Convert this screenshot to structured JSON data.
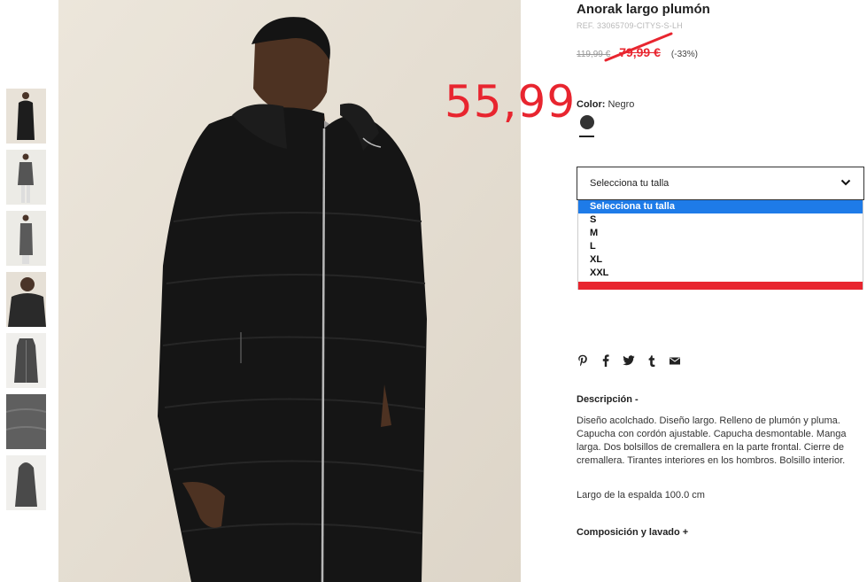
{
  "product": {
    "title": "Anorak largo plumón",
    "ref": "REF. 33065709-CITYS-S-LH",
    "old_price": "119,99 €",
    "sale_price": "79,99 €",
    "discount": "(-33%)",
    "annotation_price": "55,99"
  },
  "color": {
    "label": "Color:",
    "value": "Negro",
    "swatch": "#333333"
  },
  "size_select": {
    "placeholder": "Selecciona tu talla",
    "options": [
      "Selecciona tu talla",
      "S",
      "M",
      "L",
      "XL",
      "XXL"
    ],
    "selected_index": 0
  },
  "share_icons": [
    "pinterest-icon",
    "facebook-icon",
    "twitter-icon",
    "tumblr-icon",
    "email-icon"
  ],
  "description": {
    "title": "Descripción -",
    "text": "Diseño acolchado. Diseño largo. Relleno de plumón y pluma. Capucha con cordón ajustable. Capucha desmontable. Manga larga. Dos bolsillos de cremallera en la parte frontal. Cierre de cremallera. Tirantes interiores en los hombros. Bolsillo interior.",
    "length": "Largo de la espalda 100.0 cm"
  },
  "composition": {
    "title": "Composición y lavado +"
  },
  "colors": {
    "accent_red": "#e8252f",
    "select_highlight": "#1e7be8"
  }
}
